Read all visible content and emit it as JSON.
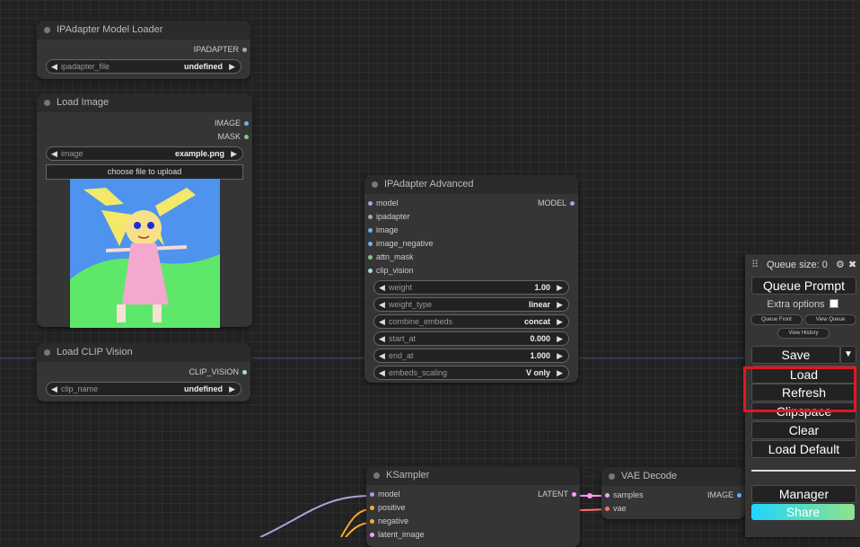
{
  "nodes": {
    "ipadapter_loader": {
      "title": "IPAdapter Model Loader",
      "output": "IPADAPTER",
      "widget_label": "ipadapter_file",
      "widget_value": "undefined"
    },
    "load_image": {
      "title": "Load Image",
      "outputs": [
        "IMAGE",
        "MASK"
      ],
      "widget_label": "image",
      "widget_value": "example.png",
      "upload_label": "choose file to upload"
    },
    "clip_vision": {
      "title": "Load CLIP Vision",
      "output": "CLIP_VISION",
      "widget_label": "clip_name",
      "widget_value": "undefined"
    },
    "ipadapter_advanced": {
      "title": "IPAdapter Advanced",
      "output": "MODEL",
      "inputs": [
        "model",
        "ipadapter",
        "image",
        "image_negative",
        "attn_mask",
        "clip_vision"
      ],
      "widgets": [
        {
          "label": "weight",
          "value": "1.00"
        },
        {
          "label": "weight_type",
          "value": "linear"
        },
        {
          "label": "combine_embeds",
          "value": "concat"
        },
        {
          "label": "start_at",
          "value": "0.000"
        },
        {
          "label": "end_at",
          "value": "1.000"
        },
        {
          "label": "embeds_scaling",
          "value": "V only"
        }
      ]
    },
    "ksampler": {
      "title": "KSampler",
      "output": "LATENT",
      "inputs": [
        "model",
        "positive",
        "negative",
        "latent_image"
      ]
    },
    "vae_decode": {
      "title": "VAE Decode",
      "output": "IMAGE",
      "inputs": [
        "samples",
        "vae"
      ]
    }
  },
  "menu": {
    "queue_label": "Queue size: 0",
    "queue_prompt": "Queue Prompt",
    "extra_options": "Extra options",
    "queue_front": "Queue Front",
    "view_queue": "View Queue",
    "view_history": "View History",
    "save": "Save",
    "load": "Load",
    "refresh": "Refresh",
    "clipspace": "Clipspace",
    "clear": "Clear",
    "load_default": "Load Default",
    "manager": "Manager",
    "share": "Share"
  },
  "icons": {
    "drag": "drag-handle-icon",
    "settings": "gear-icon",
    "close": "close-icon",
    "dropdown": "caret-down-icon",
    "arrow_left": "arrow-left-icon",
    "arrow_right": "arrow-right-icon"
  },
  "colors": {
    "canvas": "#222222",
    "node": "#353535",
    "node_title": "#2b2b2b",
    "slot_model": "#b39ddb",
    "slot_image": "#64b5f6",
    "slot_mask": "#81c784",
    "slot_conditioning": "#ffa931",
    "slot_latent": "#ff9cf9",
    "slot_vae": "#ff6e6e",
    "slot_clip_vision": "#a8dadc",
    "highlight": "#e8141d"
  }
}
